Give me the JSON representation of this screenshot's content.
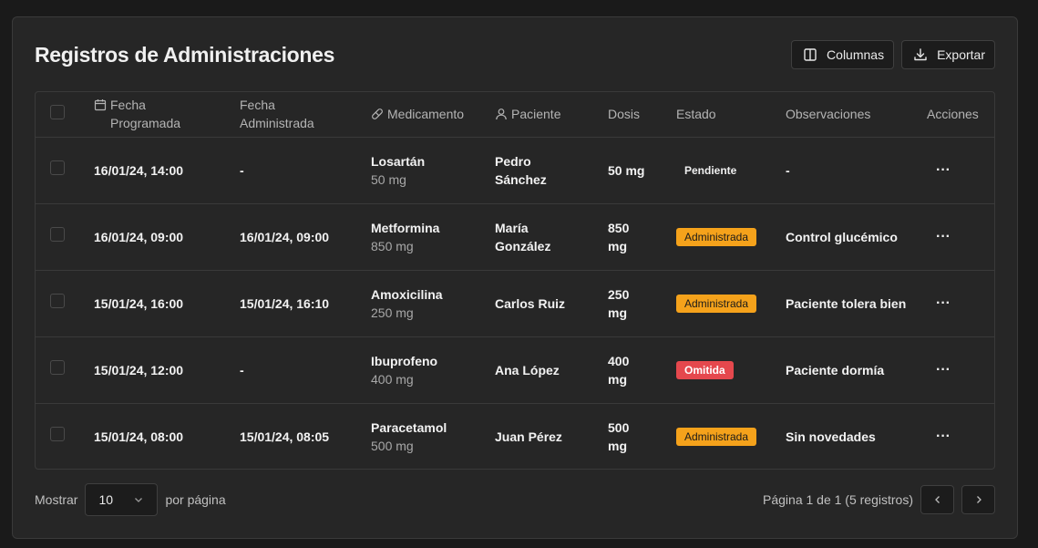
{
  "header": {
    "title": "Registros de Administraciones",
    "columns_label": "Columnas",
    "export_label": "Exportar"
  },
  "table": {
    "headers": {
      "scheduled_line1": "Fecha",
      "scheduled_line2": "Programada",
      "administered_line1": "Fecha",
      "administered_line2": "Administrada",
      "medication": "Medicamento",
      "patient": "Paciente",
      "dose": "Dosis",
      "status": "Estado",
      "notes": "Observaciones",
      "actions": "Acciones"
    },
    "rows": [
      {
        "scheduled": "16/01/24, 14:00",
        "administered": "-",
        "medication": "Losartán",
        "med_dose": "50 mg",
        "patient_line1": "Pedro",
        "patient_line2": "Sánchez",
        "dose_line1": "50 mg",
        "dose_line2": "",
        "status": "Pendiente",
        "notes": "-",
        "actions": "···"
      },
      {
        "scheduled": "16/01/24, 09:00",
        "administered": "16/01/24, 09:00",
        "medication": "Metformina",
        "med_dose": "850 mg",
        "patient_line1": "María",
        "patient_line2": "González",
        "dose_line1": "850",
        "dose_line2": "mg",
        "status": "Administrada",
        "notes": "Control glucémico",
        "actions": "···"
      },
      {
        "scheduled": "15/01/24, 16:00",
        "administered": "15/01/24, 16:10",
        "medication": "Amoxicilina",
        "med_dose": "250 mg",
        "patient_line1": "Carlos Ruiz",
        "patient_line2": "",
        "dose_line1": "250",
        "dose_line2": "mg",
        "status": "Administrada",
        "notes": "Paciente tolera bien",
        "actions": "···"
      },
      {
        "scheduled": "15/01/24, 12:00",
        "administered": "-",
        "medication": "Ibuprofeno",
        "med_dose": "400 mg",
        "patient_line1": "Ana López",
        "patient_line2": "",
        "dose_line1": "400",
        "dose_line2": "mg",
        "status": "Omitida",
        "notes": "Paciente dormía",
        "actions": "···"
      },
      {
        "scheduled": "15/01/24, 08:00",
        "administered": "15/01/24, 08:05",
        "medication": "Paracetamol",
        "med_dose": "500 mg",
        "patient_line1": "Juan Pérez",
        "patient_line2": "",
        "dose_line1": "500",
        "dose_line2": "mg",
        "status": "Administrada",
        "notes": "Sin novedades",
        "actions": "···"
      }
    ]
  },
  "footer": {
    "show_label": "Mostrar",
    "page_size": "10",
    "per_page_label": "por página",
    "page_info": "Página 1 de 1 (5 registros)"
  },
  "colors": {
    "status_administered": "#f5a21b",
    "status_omitted": "#e5484d",
    "background": "#262626"
  },
  "icons": {
    "columns": "columns-icon",
    "export": "download-icon",
    "scheduled": "calendar-icon",
    "medication": "pill-icon",
    "patient": "user-icon",
    "select": "chevron-down-icon",
    "prev": "chevron-left-icon",
    "next": "chevron-right-icon"
  }
}
